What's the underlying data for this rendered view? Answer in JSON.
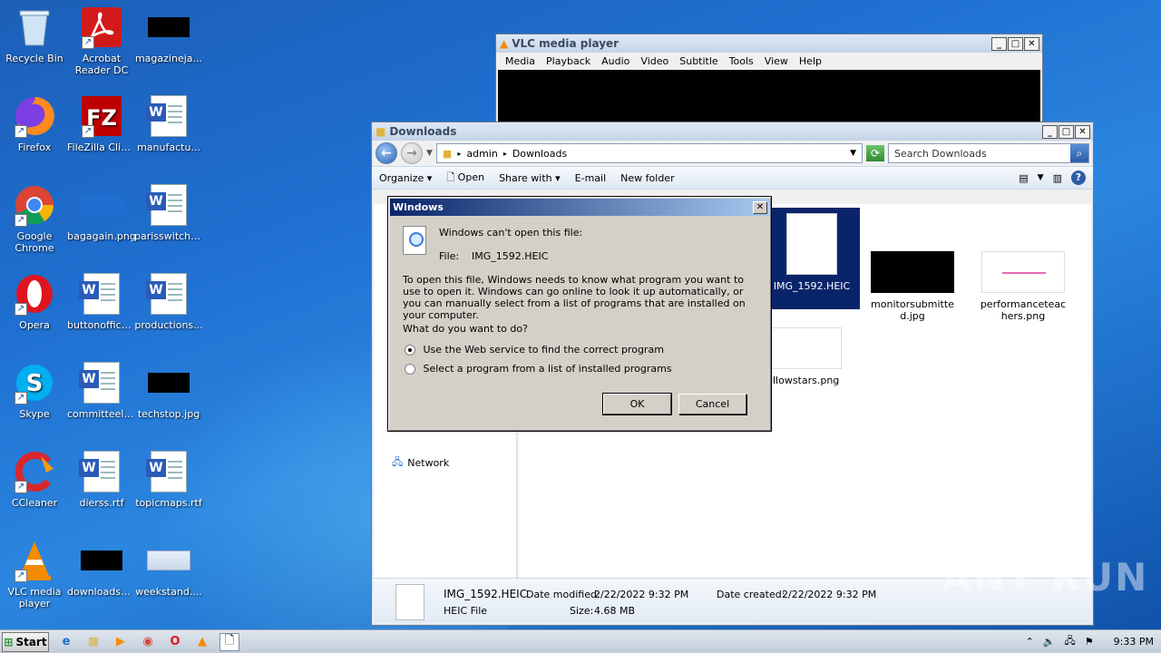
{
  "desktop": {
    "icons": [
      {
        "label": "Recycle Bin"
      },
      {
        "label": "Acrobat Reader DC"
      },
      {
        "label": "magazineja..."
      },
      {
        "label": "Firefox"
      },
      {
        "label": "FileZilla Client"
      },
      {
        "label": "manufactu..."
      },
      {
        "label": "Google Chrome"
      },
      {
        "label": "bagagain.png"
      },
      {
        "label": "parisswitch.rtf"
      },
      {
        "label": "Opera"
      },
      {
        "label": "buttonoffice..."
      },
      {
        "label": "productions..."
      },
      {
        "label": "Skype"
      },
      {
        "label": "committeela..."
      },
      {
        "label": "techstop.jpg"
      },
      {
        "label": "CCleaner"
      },
      {
        "label": "dierss.rtf"
      },
      {
        "label": "topicmaps.rtf"
      },
      {
        "label": "VLC media player"
      },
      {
        "label": "downloadse..."
      },
      {
        "label": "weekstand...."
      }
    ]
  },
  "vlc": {
    "title": "VLC media player",
    "menu": [
      "Media",
      "Playback",
      "Audio",
      "Video",
      "Subtitle",
      "Tools",
      "View",
      "Help"
    ]
  },
  "explorer": {
    "title": "Downloads",
    "breadcrumb": [
      "admin",
      "Downloads"
    ],
    "search_placeholder": "Search Downloads",
    "commands": [
      "Organize",
      "Open",
      "Share with",
      "E-mail",
      "New folder"
    ],
    "nav_network": "Network",
    "files": [
      {
        "name": "IMG_1592.HEIC"
      },
      {
        "name": "monitorsubmitted.jpg"
      },
      {
        "name": "performanceteachers.png"
      },
      {
        "name": "yellowstars.png"
      }
    ],
    "details": {
      "name": "IMG_1592.HEIC",
      "type": "HEIC File",
      "modified_label": "Date modified:",
      "modified": "2/22/2022 9:32 PM",
      "created_label": "Date created:",
      "created": "2/22/2022 9:32 PM",
      "size_label": "Size:",
      "size": "4.68 MB"
    }
  },
  "dialog": {
    "title": "Windows",
    "heading": "Windows can't open this file:",
    "file_label": "File:",
    "file_name": "IMG_1592.HEIC",
    "body": "To open this file, Windows needs to know what program you want to use to open it. Windows can go online to look it up automatically, or you can manually select from a list of programs that are installed on your computer.",
    "question": "What do you want to do?",
    "option_web": "Use the Web service to find the correct program",
    "option_list": "Select a program from a list of installed programs",
    "ok": "OK",
    "cancel": "Cancel"
  },
  "taskbar": {
    "start": "Start",
    "clock": "9:33 PM"
  },
  "watermark": "ANY RUN"
}
